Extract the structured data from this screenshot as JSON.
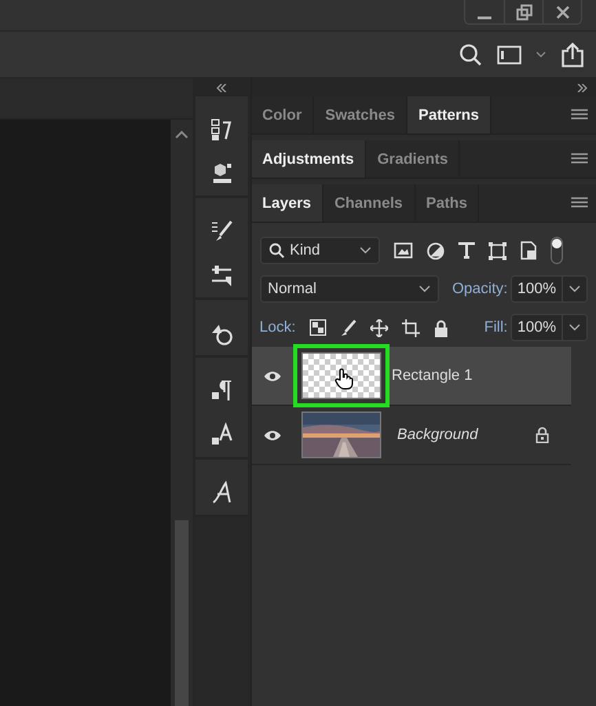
{
  "panel_groups": [
    {
      "tabs": [
        {
          "label": "Color",
          "selected": false
        },
        {
          "label": "Swatches",
          "selected": false
        },
        {
          "label": "Patterns",
          "selected": true
        }
      ]
    },
    {
      "tabs": [
        {
          "label": "Adjustments",
          "selected": true
        },
        {
          "label": "Gradients",
          "selected": false
        }
      ]
    },
    {
      "tabs": [
        {
          "label": "Layers",
          "selected": true
        },
        {
          "label": "Channels",
          "selected": false
        },
        {
          "label": "Paths",
          "selected": false
        }
      ]
    }
  ],
  "filter": {
    "value": "Kind"
  },
  "blend_mode": {
    "value": "Normal"
  },
  "opacity": {
    "label": "Opacity:",
    "value": "100%"
  },
  "lock": {
    "label": "Lock:"
  },
  "fill": {
    "label": "Fill:",
    "value": "100%"
  },
  "layers": [
    {
      "name": "Rectangle 1",
      "kind": "transparent",
      "selected": true,
      "visible": true,
      "locked": false,
      "highlighted": true
    },
    {
      "name": "Background",
      "kind": "picture",
      "selected": false,
      "visible": true,
      "locked": true,
      "highlighted": false
    }
  ]
}
